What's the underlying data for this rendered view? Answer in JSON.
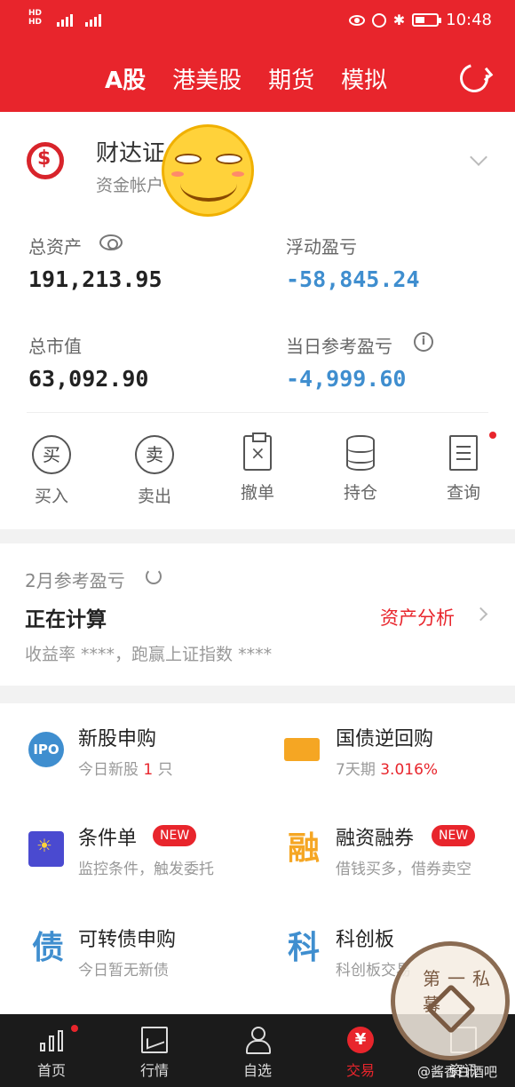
{
  "status_bar": {
    "sim1": "HD 4G",
    "sim2": "HD 4G",
    "time": "10:48"
  },
  "header": {
    "tabs": [
      {
        "label": "A股",
        "active": true
      },
      {
        "label": "港美股",
        "active": false
      },
      {
        "label": "期货",
        "active": false
      },
      {
        "label": "模拟",
        "active": false
      }
    ]
  },
  "account": {
    "broker_name": "财达证",
    "broker_sub": "资金帐户",
    "total_assets_label": "总资产",
    "total_assets": "191,213.95",
    "floating_pl_label": "浮动盈亏",
    "floating_pl": "-58,845.24",
    "market_value_label": "总市值",
    "market_value": "63,092.90",
    "daily_pl_label": "当日参考盈亏",
    "daily_pl": "-4,999.60"
  },
  "actions": [
    {
      "label": "买入",
      "icon": "buy-icon",
      "glyph": "买"
    },
    {
      "label": "卖出",
      "icon": "sell-icon",
      "glyph": "卖"
    },
    {
      "label": "撤单",
      "icon": "cancel-order-icon"
    },
    {
      "label": "持仓",
      "icon": "holdings-icon"
    },
    {
      "label": "查询",
      "icon": "query-icon"
    }
  ],
  "monthly": {
    "title": "2月参考盈亏",
    "status": "正在计算",
    "link": "资产分析",
    "note": "收益率 ****，跑赢上证指数 ****"
  },
  "services": [
    {
      "title": "新股申购",
      "sub_prefix": "今日新股 ",
      "sub_highlight": "1",
      "sub_suffix": " 只",
      "icon_text": "IPO"
    },
    {
      "title": "国债逆回购",
      "sub_prefix": "7天期 ",
      "sub_highlight": "3.016%",
      "sub_suffix": ""
    },
    {
      "title": "条件单",
      "badge": "NEW",
      "sub_prefix": "监控条件，触发委托",
      "sub_highlight": "",
      "sub_suffix": ""
    },
    {
      "title": "融资融券",
      "badge": "NEW",
      "sub_prefix": "借钱买多，借券卖空",
      "sub_highlight": "",
      "sub_suffix": "",
      "icon_text": "融"
    },
    {
      "title": "可转债申购",
      "sub_prefix": "今日暂无新债",
      "sub_highlight": "",
      "sub_suffix": "",
      "icon_text": "债"
    },
    {
      "title": "科创板",
      "sub_prefix": "科创板交易",
      "sub_highlight": "",
      "sub_suffix": "",
      "icon_text": "科"
    }
  ],
  "bottom_nav": [
    {
      "label": "首页",
      "active": false
    },
    {
      "label": "行情",
      "active": false
    },
    {
      "label": "自选",
      "active": false
    },
    {
      "label": "交易",
      "active": true,
      "icon_text": "¥"
    },
    {
      "label": "资讯",
      "active": false
    }
  ],
  "overlay": {
    "stamp_text": "第一私募",
    "watermark": "@酱香白酒吧"
  },
  "colors": {
    "brand_red": "#e8252c",
    "negative_blue": "#3f8ecf"
  }
}
